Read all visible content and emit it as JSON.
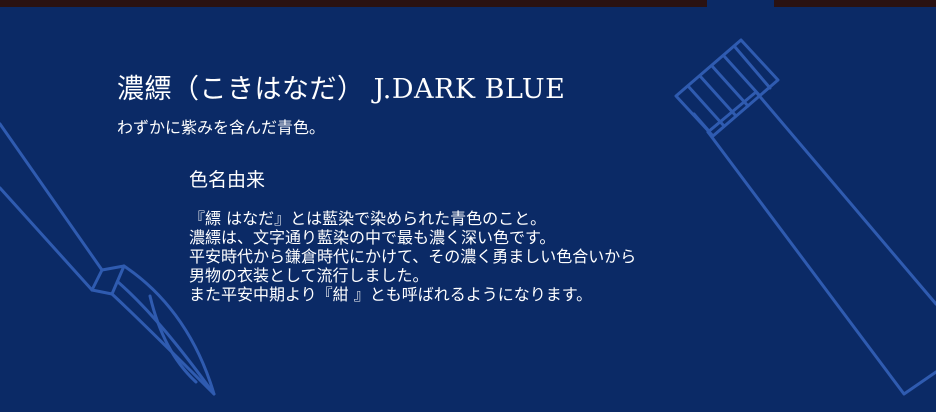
{
  "title": "濃縹（こきはなだ） J.DARK BLUE",
  "subtitle": "わずかに紫みを含んだ青色。",
  "section_heading": "色名由来",
  "body_lines": [
    "『縹 はなだ』とは藍染で染められた青色のこと。",
    "濃縹は、文字通り藍染の中で最も濃く深い色です。",
    "平安時代から鎌倉時代にかけて、その濃く勇ましい色合いから",
    "男物の衣装として流行しました。",
    "また平安中期より『紺 』とも呼ばれるようになります。"
  ],
  "colors": {
    "background": "#0b2a66",
    "top_bar": "#2a1212",
    "line_art": "#2f5bb0",
    "text": "#ffffff"
  },
  "icons": [
    "brush-icon",
    "paint-tube-icon"
  ]
}
